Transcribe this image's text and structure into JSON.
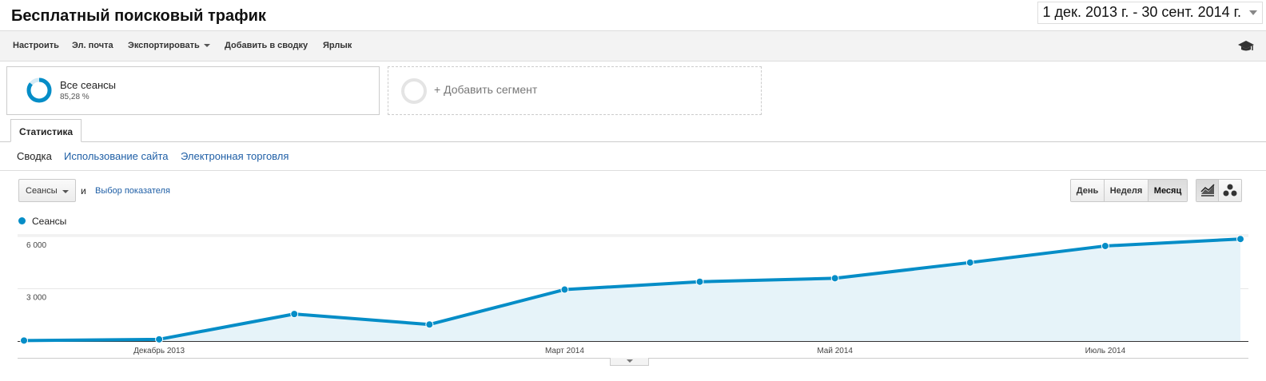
{
  "header": {
    "title": "Бесплатный поисковый трафик",
    "date_range": "1 дек. 2013 г. - 30 сент. 2014 г."
  },
  "toolbar": {
    "customize": "Настроить",
    "email": "Эл. почта",
    "export": "Экспортировать",
    "add_to_dashboard": "Добавить в сводку",
    "shortcut": "Ярлык",
    "academy_icon": "graduation-cap-icon"
  },
  "segments": {
    "active": {
      "name": "Все сеансы",
      "percent": "85,28 %",
      "percent_value": 85.28
    },
    "add_label": "+ Добавить сегмент"
  },
  "tabs": {
    "active": "Статистика"
  },
  "subnav": {
    "items": [
      "Сводка",
      "Использование сайта",
      "Электронная торговля"
    ],
    "current_index": 0
  },
  "controls": {
    "metric_select": "Сеансы",
    "conjunction": "и",
    "choose_metric": "Выбор показателя",
    "granularity": [
      "День",
      "Неделя",
      "Месяц"
    ],
    "granularity_selected": "Месяц",
    "chart_types": [
      "line-chart-icon",
      "motion-chart-icon"
    ],
    "chart_type_selected": "line-chart-icon"
  },
  "colors": {
    "series": "#058dc7",
    "area_fill": "#e6f3f9",
    "link": "#1f5fa6"
  },
  "chart_data": {
    "type": "area",
    "title": "",
    "ylabel": "",
    "xlabel": "",
    "ylim": [
      0,
      6500
    ],
    "y_ticks": [
      {
        "value": 3000,
        "label": "3 000"
      },
      {
        "value": 6000,
        "label": "6 000"
      }
    ],
    "x_tick_labels": [
      {
        "index": 1,
        "label": "Декабрь 2013"
      },
      {
        "index": 4,
        "label": "Март 2014"
      },
      {
        "index": 6,
        "label": "Май 2014"
      },
      {
        "index": 8,
        "label": "Июль 2014"
      }
    ],
    "grid": true,
    "legend_position": "top-left",
    "series": [
      {
        "name": "Сеансы",
        "values": [
          30,
          100,
          1550,
          950,
          2950,
          3400,
          3600,
          4500,
          5450,
          5850
        ]
      }
    ]
  }
}
